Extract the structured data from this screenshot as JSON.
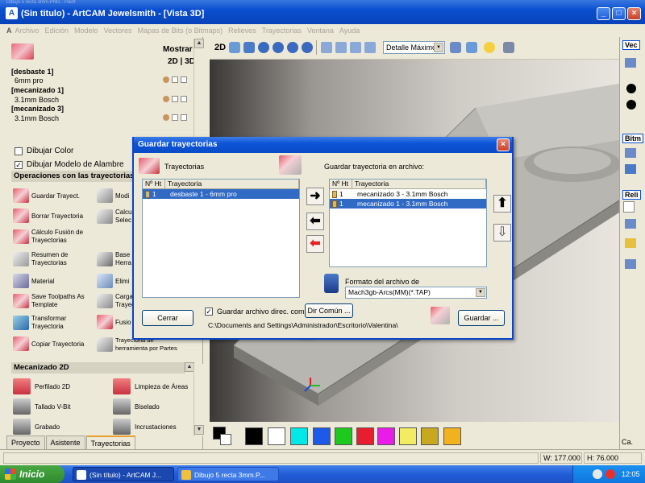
{
  "window": {
    "title": "(Sin titulo) - ArtCAM Jewelsmith - [Vista 3D]",
    "prev_title_fragment": "Dibujo 5 recta 3mm.PNG - Paint"
  },
  "menu": [
    "Archivo",
    "Edición",
    "Modelo",
    "Vectores",
    "Mapas de Bits (o Bitmaps)",
    "Relieves",
    "Trayectorias",
    "Ventana",
    "Ayuda"
  ],
  "left_panel": {
    "mostrar_label": "Mostrar",
    "mode_2d3d": "2D | 3D",
    "toolpaths": [
      {
        "name": "[desbaste 1]",
        "tool": "6mm pro"
      },
      {
        "name": "[mecanizado 1]",
        "tool": "3.1mm Bosch"
      },
      {
        "name": "[mecanizado 3]",
        "tool": "3.1mm Bosch"
      }
    ],
    "dibujar_color": "Dibujar Color",
    "dibujar_color_checked": false,
    "dibujar_modelo": "Dibujar Modelo de Alambre",
    "dibujar_modelo_checked": true,
    "ops_header": "Operaciones con las trayectorias",
    "ops_left": [
      [
        "Guardar Trayect."
      ],
      [
        "Borrar Trayectoria"
      ],
      [
        "Cálculo Fusión de",
        "Trayectorias"
      ],
      [
        "Resumen de",
        "Trayectorias"
      ],
      [
        "Material"
      ],
      [
        "Save Toolpaths As",
        "Template"
      ],
      [
        "Transformar",
        "Trayectoria"
      ],
      [
        "Copiar Trayectoria"
      ]
    ],
    "ops_right": [
      [
        "Modi"
      ],
      [
        "Calcu",
        "Selec"
      ],
      [
        ""
      ],
      [
        "Base",
        "Herra"
      ],
      [
        "Elimi"
      ],
      [
        "Carga",
        "Trayec"
      ],
      [
        "Fusio"
      ],
      [
        "Trayectoria de",
        "herramienta por Partes"
      ]
    ],
    "mec2d_header": "Mecanizado 2D",
    "mec2d": [
      [
        "Perfilado 2D",
        "Limpieza de Áreas"
      ],
      [
        "Tallado V-Bit",
        "Biselado"
      ],
      [
        "Grabado",
        "Incrustaciones"
      ]
    ],
    "tabs": [
      "Proyecto",
      "Asistente",
      "Trayectorias"
    ],
    "active_tab": "Trayectorias"
  },
  "toolbar": {
    "label_2d": "2D",
    "detail_select": "Detalle Máximo"
  },
  "right_panel": {
    "labels": [
      "Vec",
      "Bitm",
      "Reli",
      "Ca."
    ]
  },
  "dialog": {
    "title": "Guardar trayectorias",
    "left_group_label": "Trayectorias",
    "right_group_label": "Guardar trayectoria en archivo:",
    "col_nht": "Nº Ht",
    "col_tray": "Trayectoria",
    "left_rows": [
      {
        "n": "1",
        "name": "desbaste 1 - 6mm pro",
        "selected": true
      }
    ],
    "right_rows": [
      {
        "n": "1",
        "name": "mecanizado 3 - 3.1mm Bosch",
        "selected": false
      },
      {
        "n": "1",
        "name": "mecanizado 1 - 3.1mm Bosch",
        "selected": true
      }
    ],
    "format_label": "Formato del archivo de",
    "format_value": "Mach3gb-Arcs(MM)(*.TAP)",
    "cerrar": "Cerrar",
    "guardar_dir_label": "Guardar archivo direc. comú",
    "guardar_dir_checked": true,
    "dir_comun": "Dir Común ...",
    "path": "C:\\Documents and Settings\\Administrador\\Escritorio\\Valentina\\",
    "guardar": "Guardar ..."
  },
  "palette": {
    "colors": [
      "#000000",
      "#ffffff",
      "#00e8e8",
      "#1e5ae8",
      "#1ec81e",
      "#e81e2e",
      "#e81ee8",
      "#f2ec62",
      "#c8a81e",
      "#f2b21e"
    ]
  },
  "status": {
    "width": "W: 177.000",
    "height": "H: 76.000"
  },
  "taskbar": {
    "start": "Inicio",
    "tasks": [
      "(Sin título) - ArtCAM J...",
      "Dibujo 5 recta 3mm.P..."
    ],
    "clock": "12:05"
  }
}
